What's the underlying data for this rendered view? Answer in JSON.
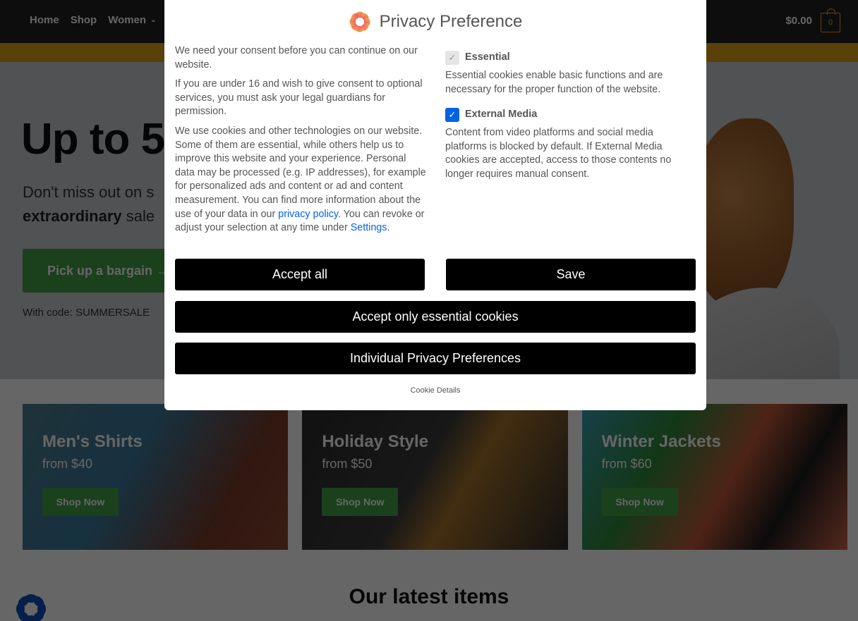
{
  "site": {
    "nav": {
      "items": [
        {
          "label": "Home"
        },
        {
          "label": "Shop"
        },
        {
          "label": "Women",
          "has_dropdown": true
        }
      ],
      "caret_icon": "⌄",
      "cart_total": "$0.00",
      "cart_count": "0"
    },
    "hero": {
      "title": "Up to 5",
      "subtitle_start": "Don't miss out on s",
      "subtitle_bold": "extraordinary",
      "subtitle_end": " sale",
      "cta_label": "Pick up a bargain →",
      "code_text": "With code: SUMMERSALE"
    },
    "cards": [
      {
        "title": "Men's Shirts",
        "price": "from $40",
        "button": "Shop Now"
      },
      {
        "title": "Holiday Style",
        "price": "from $50",
        "button": "Shop Now"
      },
      {
        "title": "Winter Jackets",
        "price": "from $60",
        "button": "Shop Now"
      }
    ],
    "latest_heading": "Our latest items"
  },
  "modal": {
    "title": "Privacy Preference",
    "intro_1": "We need your consent before you can continue on our website.",
    "intro_2": "If you are under 16 and wish to give consent to optional services, you must ask your legal guardians for permission.",
    "intro_3_start": "We use cookies and other technologies on our website. Some of them are essential, while others help us to improve this website and your experience. Personal data may be processed (e.g. IP addresses), for example for personalized ads and content or ad and content measurement. You can find more information about the use of your data in our ",
    "privacy_link": "privacy policy",
    "intro_3_mid": ". You can revoke or adjust your selection at any time under ",
    "settings_link": "Settings",
    "intro_3_end": ".",
    "consents": [
      {
        "label": "Essential",
        "checked": true,
        "disabled": true,
        "description": "Essential cookies enable basic functions and are necessary for the proper function of the website."
      },
      {
        "label": "External Media",
        "checked": true,
        "disabled": false,
        "description": "Content from video platforms and social media platforms is blocked by default. If External Media cookies are accepted, access to those contents no longer requires manual consent."
      }
    ],
    "check_icon": "✓",
    "buttons": {
      "accept_all": "Accept all",
      "save": "Save",
      "accept_essential": "Accept only essential cookies",
      "individual": "Individual Privacy Preferences"
    },
    "cookie_details": "Cookie Details"
  },
  "colors": {
    "accent_blue": "#0063e3",
    "green_cta": "#43a147",
    "promo_bar": "#e1a118",
    "nav_bg": "#222222",
    "button_black": "#000000"
  }
}
